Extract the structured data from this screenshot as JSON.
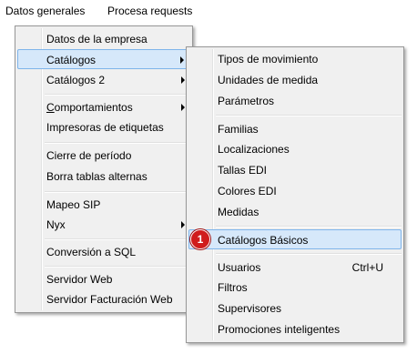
{
  "menubar": {
    "items": [
      {
        "label": "Datos generales"
      },
      {
        "label": "Procesa requests"
      }
    ]
  },
  "menu1": {
    "items": [
      {
        "label": "Datos de la empresa"
      },
      {
        "label": "Catálogos"
      },
      {
        "label": "Catálogos 2"
      },
      {
        "label_prefix": "C",
        "label_rest": "omportamientos"
      },
      {
        "label": "Impresoras de etiquetas"
      },
      {
        "label": "Cierre de período"
      },
      {
        "label": "Borra tablas alternas"
      },
      {
        "label": "Mapeo SIP"
      },
      {
        "label": "Nyx"
      },
      {
        "label": "Conversión a SQL"
      },
      {
        "label": "Servidor Web"
      },
      {
        "label": "Servidor Facturación Web"
      }
    ]
  },
  "menu2": {
    "items": [
      {
        "label": "Tipos de movimiento"
      },
      {
        "label": "Unidades de medida"
      },
      {
        "label": "Parámetros"
      },
      {
        "label": "Familias"
      },
      {
        "label": "Localizaciones"
      },
      {
        "label": "Tallas EDI"
      },
      {
        "label": "Colores EDI"
      },
      {
        "label": "Medidas"
      },
      {
        "label": "Catálogos Básicos"
      },
      {
        "label": "Usuarios",
        "shortcut": "Ctrl+U"
      },
      {
        "label": "Filtros"
      },
      {
        "label": "Supervisores"
      },
      {
        "label": "Promociones inteligentes"
      }
    ]
  },
  "annotation": {
    "number": "1"
  }
}
